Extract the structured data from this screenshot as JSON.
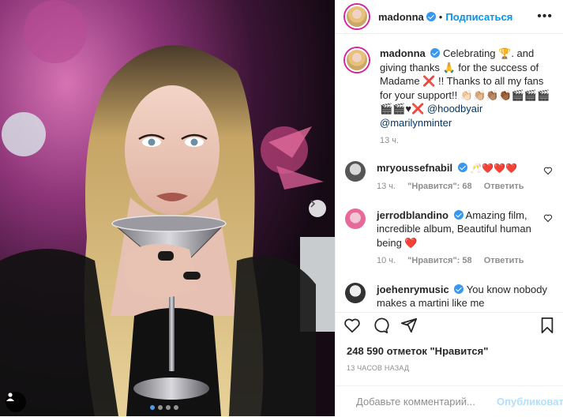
{
  "post": {
    "image_alt": "Madonna holding a martini glass",
    "carousel_dots": 4,
    "active_dot": 0
  },
  "header": {
    "username": "madonna",
    "separator": "•",
    "follow_label": "Подписаться",
    "more_label": "•••"
  },
  "caption": {
    "username": "madonna",
    "text": "Celebrating 🏆. and giving thanks 🙏 for the success of Madame ❌ !! Thanks to all my fans for your support!! 👏🏻👏🏼👏🏽👏🏾🎬🎬🎬🎬🎬♥❌",
    "mentions": [
      "@hoodbyair",
      "@marilynminter"
    ],
    "time": "13 ч."
  },
  "comments": [
    {
      "username": "mryoussefnabil",
      "text": "🥂❤️❤️❤️",
      "time": "13 ч.",
      "likes": "\"Нравится\": 68",
      "reply": "Ответить"
    },
    {
      "username": "jerrodblandino",
      "text": "Amazing film, incredible album, Beautiful human being ❤️",
      "time": "10 ч.",
      "likes": "\"Нравится\": 58",
      "reply": "Ответить"
    },
    {
      "username": "joehenrymusic",
      "text": "You know nobody makes a martini like me",
      "time": "",
      "likes": "",
      "reply": ""
    }
  ],
  "likes_text": "248 590 отметок \"Нравится\"",
  "date_text": "13 ЧАСОВ НАЗАД",
  "add_comment": {
    "placeholder": "Добавьте комментарий...",
    "publish_label": "Опубликовать"
  },
  "colors": {
    "accent": "#0095f6",
    "verified": "#3897f0",
    "heart": "#ed4956",
    "muted": "#8e8e8e"
  },
  "icons": [
    "heart-icon",
    "comment-icon",
    "share-icon",
    "bookmark-icon",
    "chevron-right-icon",
    "user-tag-icon",
    "emoji-icon",
    "verified-icon"
  ]
}
